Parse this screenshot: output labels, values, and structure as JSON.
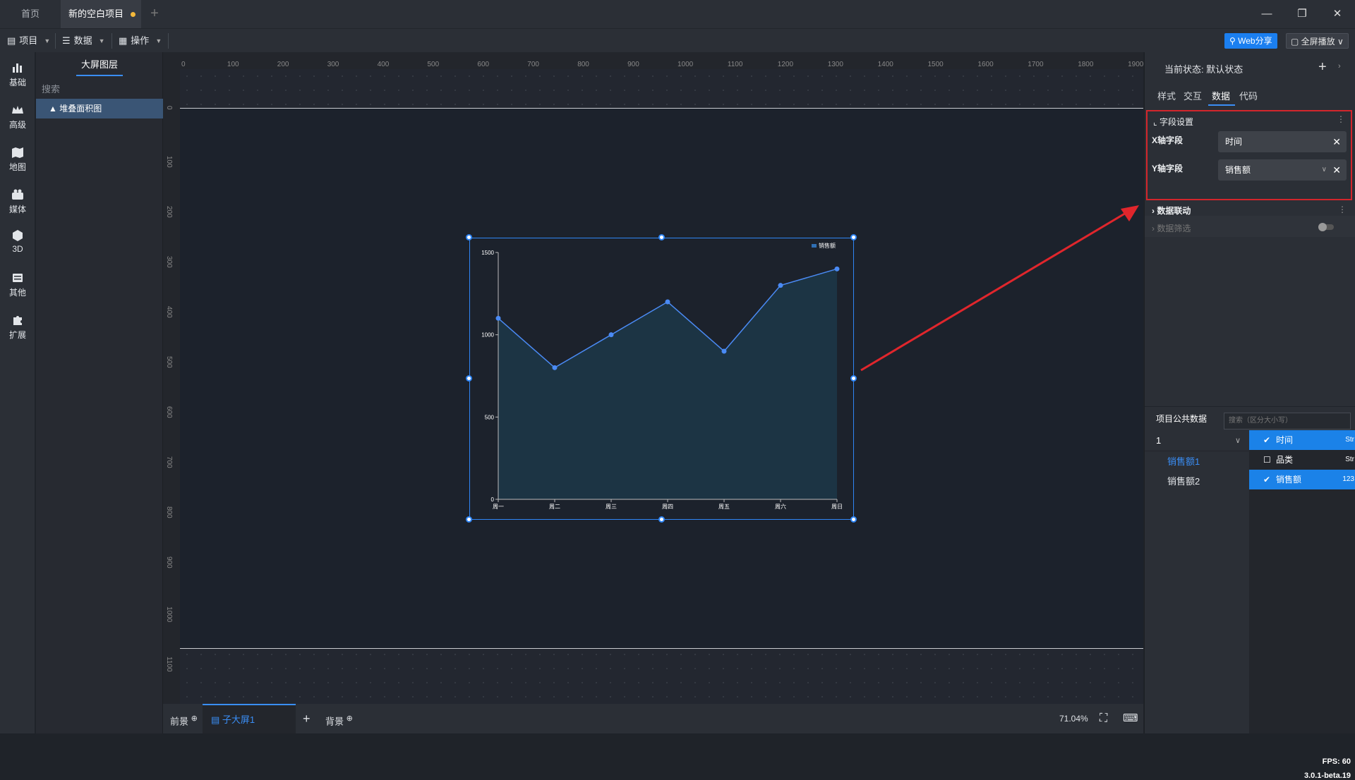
{
  "tabs": {
    "home": "首页",
    "project": "新的空白项目",
    "add": "+"
  },
  "toolbar": {
    "project": "项目",
    "data": "数据",
    "operate": "操作",
    "web_share": "Web分享",
    "fullscreen": "全屏播放"
  },
  "nav": [
    {
      "label": "基础",
      "icon": "bar-chart-icon"
    },
    {
      "label": "高级",
      "icon": "crown-icon"
    },
    {
      "label": "地图",
      "icon": "map-icon"
    },
    {
      "label": "媒体",
      "icon": "camera-icon"
    },
    {
      "label": "3D",
      "icon": "cube-icon"
    },
    {
      "label": "其他",
      "icon": "list-icon"
    },
    {
      "label": "扩展",
      "icon": "puzzle-icon"
    }
  ],
  "layers": {
    "title": "大屏图层",
    "search": "搜索",
    "item": "堆叠面积图"
  },
  "ruler": {
    "top": [
      "0",
      "100",
      "200",
      "300",
      "400",
      "500",
      "600",
      "700",
      "800",
      "900",
      "1000",
      "1100",
      "1200",
      "1300",
      "1400",
      "1500",
      "1600",
      "1700",
      "1800",
      "1900"
    ],
    "left": [
      "0",
      "100",
      "200",
      "300",
      "400",
      "500",
      "600",
      "700",
      "800",
      "900",
      "1000",
      "1100"
    ]
  },
  "chart_data": {
    "type": "area",
    "categories": [
      "周一",
      "周二",
      "周三",
      "周四",
      "周五",
      "周六",
      "周日"
    ],
    "series": [
      {
        "name": "销售额",
        "values": [
          1100,
          800,
          1000,
          1200,
          900,
          1300,
          1400
        ]
      }
    ],
    "ylim": [
      0,
      1500
    ],
    "yticks": [
      "0",
      "500",
      "1000",
      "1500"
    ],
    "legend": "top-right",
    "colors": {
      "line": "#4a8af4",
      "area": "#1c3444"
    }
  },
  "bottom": {
    "foreground": "前景",
    "subscreen": "子大屏1",
    "background": "背景",
    "zoom": "71.04%"
  },
  "right": {
    "state_label": "当前状态:",
    "state_value": "默认状态",
    "tabs": [
      "样式",
      "交互",
      "数据",
      "代码"
    ],
    "field_section": "字段设置",
    "x_label": "X轴字段",
    "x_value": "时间",
    "y_label": "Y轴字段",
    "y_value": "销售额",
    "linkage": "数据联动",
    "filter": "数据筛选",
    "public_data": "项目公共数据",
    "search_placeholder": "搜索（区分大小写）",
    "group": "1",
    "datasets": [
      "销售额1",
      "销售额2"
    ],
    "fields": [
      {
        "name": "时间",
        "type": "Str",
        "selected": true
      },
      {
        "name": "品类",
        "type": "Str",
        "selected": false
      },
      {
        "name": "销售额",
        "type": "123",
        "selected": true
      }
    ],
    "fps": "FPS: 60",
    "version": "3.0.1-beta.19"
  }
}
